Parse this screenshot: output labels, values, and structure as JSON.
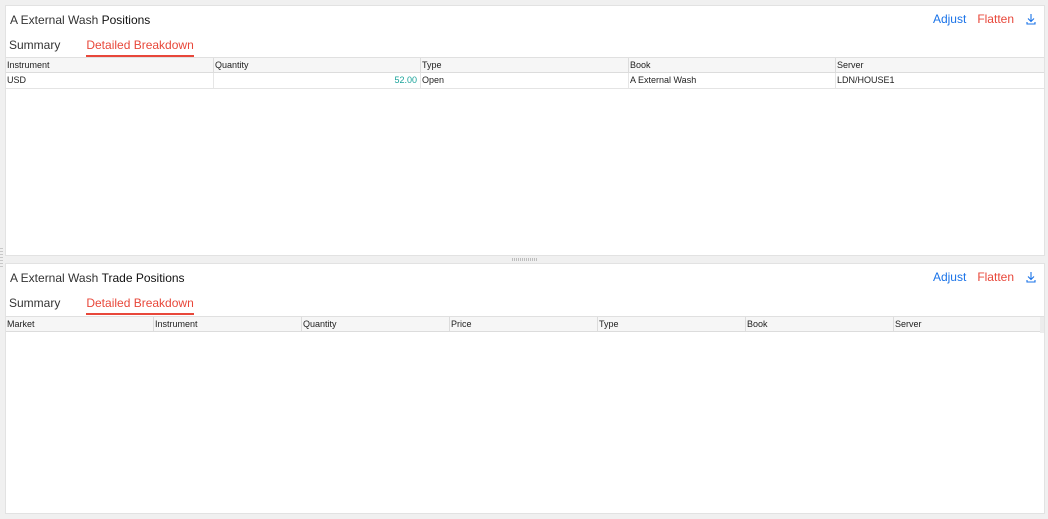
{
  "positions_panel": {
    "title_prefix": "A External Wash",
    "title_strong": "Positions",
    "adjust_label": "Adjust",
    "flatten_label": "Flatten",
    "tabs": [
      {
        "label": "Summary",
        "active": false
      },
      {
        "label": "Detailed Breakdown",
        "active": true
      }
    ],
    "columns": [
      "Instrument",
      "Quantity",
      "Type",
      "Book",
      "Server"
    ],
    "rows": [
      {
        "instrument": "USD",
        "quantity": "52.00",
        "type": "Open",
        "book": "A External Wash",
        "server": "LDN/HOUSE1"
      }
    ]
  },
  "trade_positions_panel": {
    "title_prefix": "A External Wash",
    "title_strong": "Trade Positions",
    "adjust_label": "Adjust",
    "flatten_label": "Flatten",
    "tabs": [
      {
        "label": "Summary",
        "active": false
      },
      {
        "label": "Detailed Breakdown",
        "active": true
      }
    ],
    "columns": [
      "Market",
      "Instrument",
      "Quantity",
      "Price",
      "Type",
      "Book",
      "Server"
    ],
    "rows": []
  },
  "icons": {
    "download": "download-icon",
    "splitter": "drag-handle-icon"
  },
  "colors": {
    "accent_blue": "#1a73e8",
    "accent_red": "#e8473a",
    "quantity_teal": "#1aa39a"
  }
}
